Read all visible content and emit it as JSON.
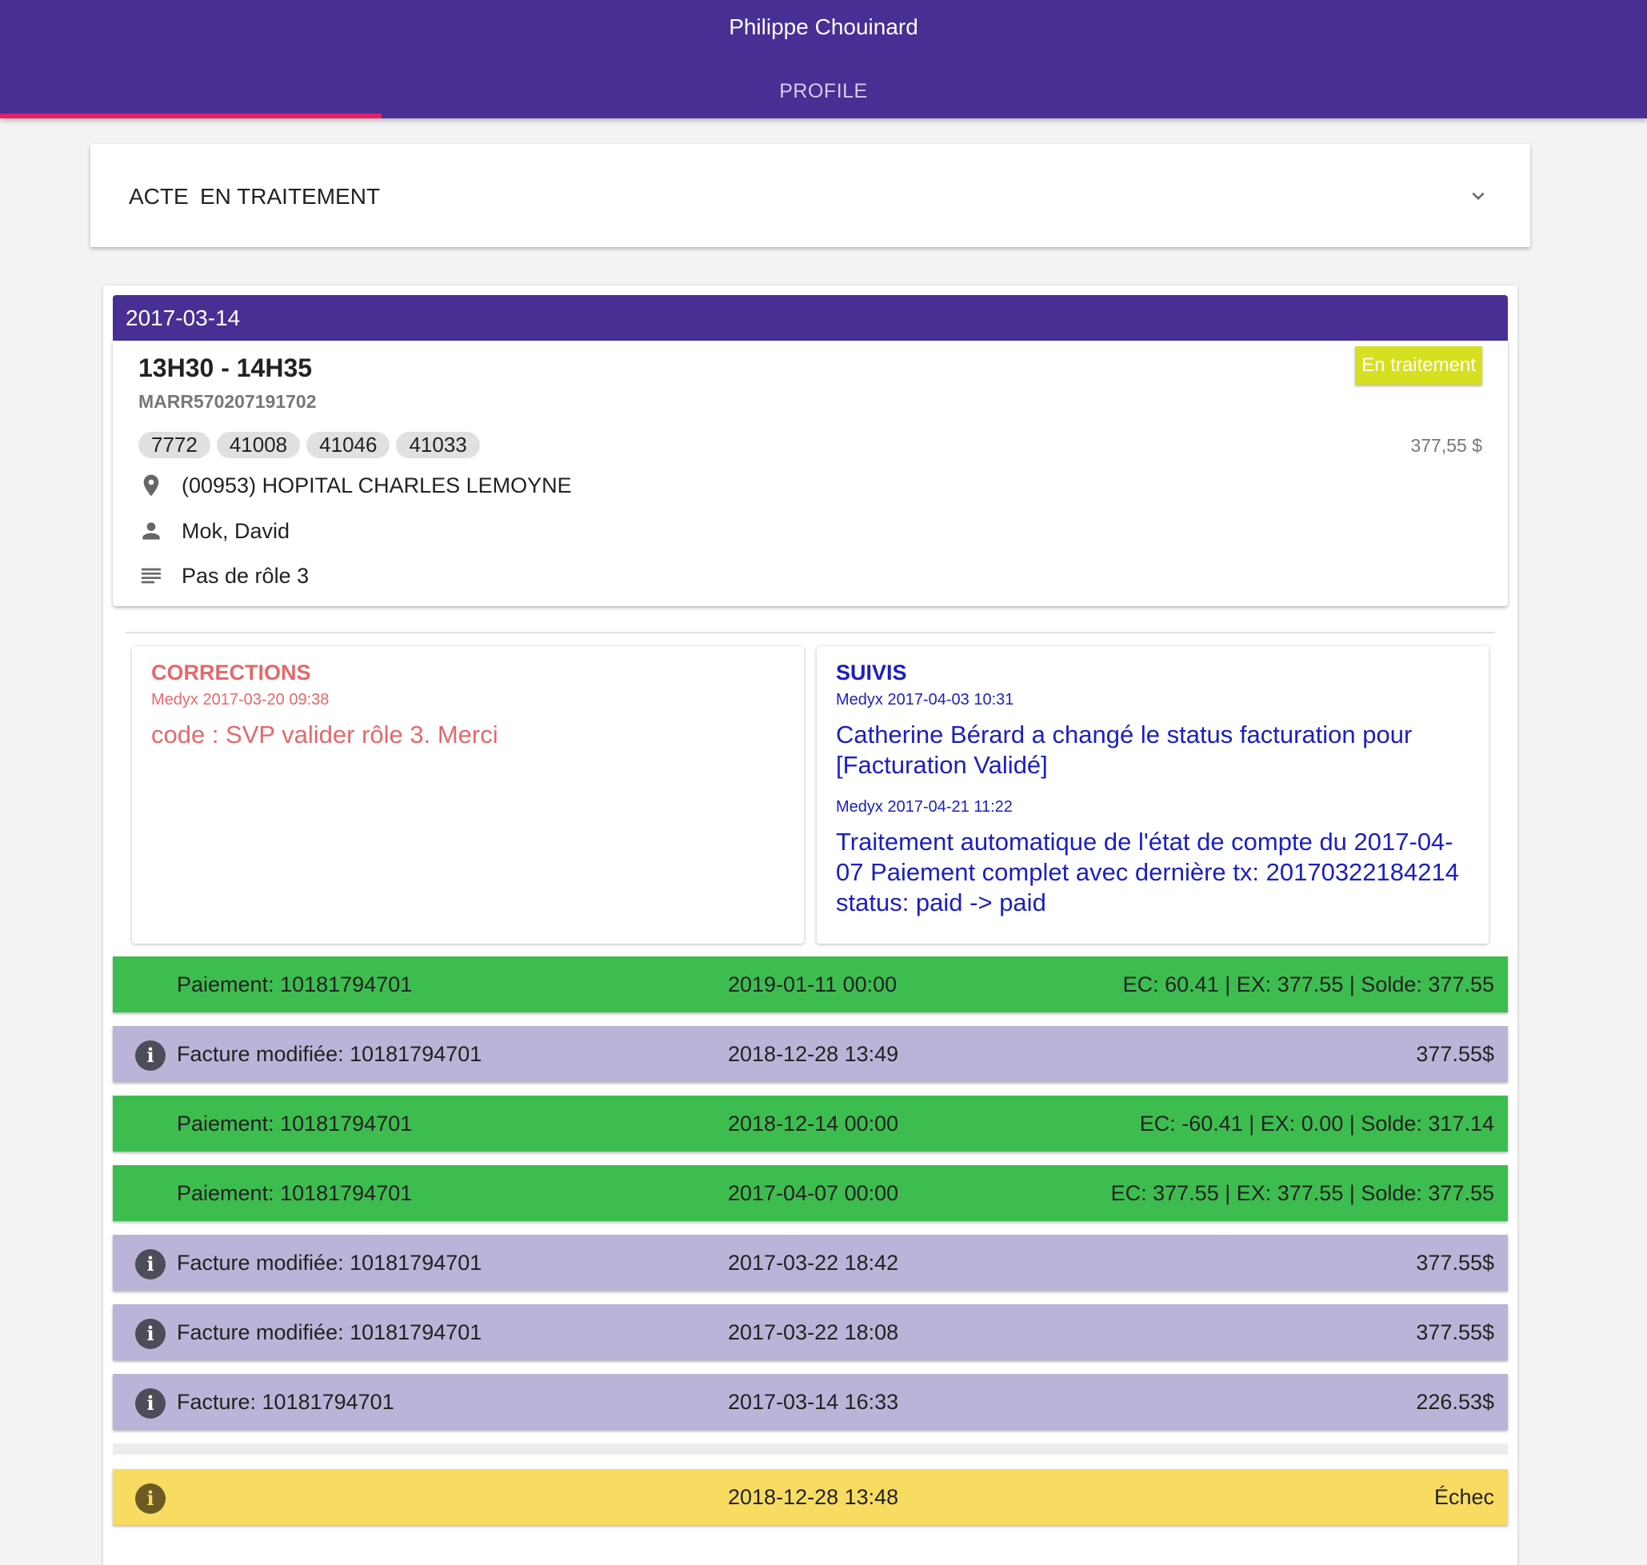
{
  "header": {
    "title": "Philippe Chouinard",
    "tab": "PROFILE"
  },
  "filter": {
    "label_acte": "ACTE",
    "label_status": "EN TRAITEMENT",
    "icon": "chevron-down-icon"
  },
  "event": {
    "date": "2017-03-14",
    "time": "13H30 - 14H35",
    "reference": "MARR570207191702",
    "status": "En traitement",
    "status_color": "#d6e020",
    "codes": [
      "7772",
      "41008",
      "41046",
      "41033"
    ],
    "amount": "377,55 $",
    "location": "(00953) HOPITAL CHARLES LEMOYNE",
    "person": "Mok, David",
    "role": "Pas de rôle 3"
  },
  "corrections": {
    "heading": "CORRECTIONS",
    "meta": "Medyx 2017-03-20 09:38",
    "text": "code : SVP valider rôle 3. Merci"
  },
  "suivis": {
    "heading": "SUIVIS",
    "entries": [
      {
        "meta": "Medyx 2017-04-03 10:31",
        "text": "Catherine Bérard a changé le status facturation pour [Facturation Validé]"
      },
      {
        "meta": "Medyx 2017-04-21 11:22",
        "text": "Traitement automatique de l'état de compte du 2017-04-07 Paiement complet avec dernière tx: 20170322184214 status: paid -> paid"
      }
    ]
  },
  "transactions": [
    {
      "label": "Paiement: 10181794701",
      "date": "2019-01-11 00:00",
      "value": "EC: 60.41 | EX: 377.55 | Solde: 377.55",
      "color": "#3dbd4f"
    },
    {
      "label": "Facture modifiée: 10181794701",
      "date": "2018-12-28 13:49",
      "value": "377.55$",
      "color": "#bbb4d8",
      "icon": "info-icon"
    },
    {
      "label": "Paiement: 10181794701",
      "date": "2018-12-14 00:00",
      "value": "EC: -60.41 | EX: 0.00 | Solde: 317.14",
      "color": "#3dbd4f"
    },
    {
      "label": "Paiement: 10181794701",
      "date": "2017-04-07 00:00",
      "value": "EC: 377.55 | EX: 377.55 | Solde: 377.55",
      "color": "#3dbd4f"
    },
    {
      "label": "Facture modifiée: 10181794701",
      "date": "2017-03-22 18:42",
      "value": "377.55$",
      "color": "#bbb4d8",
      "icon": "info-icon"
    },
    {
      "label": "Facture modifiée: 10181794701",
      "date": "2017-03-22 18:08",
      "value": "377.55$",
      "color": "#bbb4d8",
      "icon": "info-icon"
    },
    {
      "label": "Facture: 10181794701",
      "date": "2017-03-14 16:33",
      "value": "226.53$",
      "color": "#bbb4d8",
      "icon": "info-icon"
    }
  ],
  "failure": {
    "date": "2018-12-28 13:48",
    "status": "Échec",
    "color": "#f8dc62",
    "icon": "info-icon"
  },
  "colors": {
    "primary": "#472f93",
    "accent": "#e91e63",
    "corrections": "#e5686a",
    "suivis": "#1b1fc1"
  }
}
